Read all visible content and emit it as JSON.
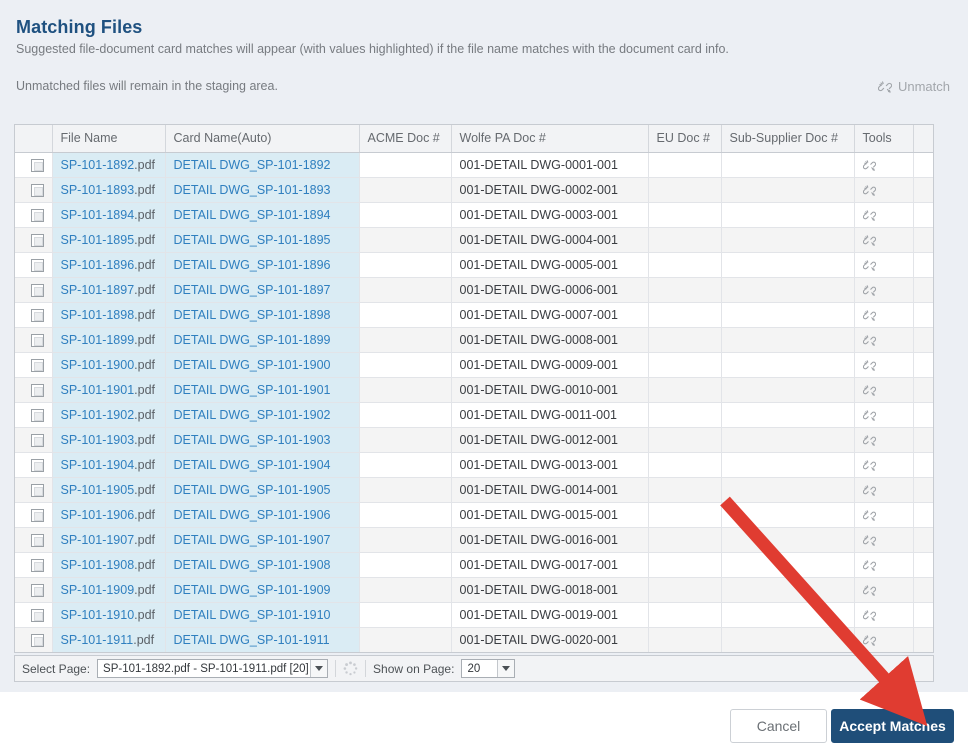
{
  "header": {
    "title": "Matching Files",
    "subtitle_1": "Suggested file-document card matches will appear (with values highlighted) if the file name matches with the document card info.",
    "subtitle_2": "Unmatched files will remain in the staging area.",
    "unmatch_label": "Unmatch",
    "unmatch_icon": "broken-link-icon"
  },
  "table": {
    "columns": [
      "",
      "File Name",
      "Card Name(Auto)",
      "ACME Doc #",
      "Wolfe PA Doc #",
      "EU Doc #",
      "Sub-Supplier Doc #",
      "Tools",
      ""
    ],
    "tools_icon": "broken-link-icon",
    "rows": [
      {
        "file": "SP-101-1892",
        "ext": ".pdf",
        "card": "DETAIL DWG_SP-101-1892",
        "acme": "",
        "wolfe": "001-DETAIL DWG-0001-001",
        "eu": "",
        "sub": ""
      },
      {
        "file": "SP-101-1893",
        "ext": ".pdf",
        "card": "DETAIL DWG_SP-101-1893",
        "acme": "",
        "wolfe": "001-DETAIL DWG-0002-001",
        "eu": "",
        "sub": ""
      },
      {
        "file": "SP-101-1894",
        "ext": ".pdf",
        "card": "DETAIL DWG_SP-101-1894",
        "acme": "",
        "wolfe": "001-DETAIL DWG-0003-001",
        "eu": "",
        "sub": ""
      },
      {
        "file": "SP-101-1895",
        "ext": ".pdf",
        "card": "DETAIL DWG_SP-101-1895",
        "acme": "",
        "wolfe": "001-DETAIL DWG-0004-001",
        "eu": "",
        "sub": ""
      },
      {
        "file": "SP-101-1896",
        "ext": ".pdf",
        "card": "DETAIL DWG_SP-101-1896",
        "acme": "",
        "wolfe": "001-DETAIL DWG-0005-001",
        "eu": "",
        "sub": ""
      },
      {
        "file": "SP-101-1897",
        "ext": ".pdf",
        "card": "DETAIL DWG_SP-101-1897",
        "acme": "",
        "wolfe": "001-DETAIL DWG-0006-001",
        "eu": "",
        "sub": ""
      },
      {
        "file": "SP-101-1898",
        "ext": ".pdf",
        "card": "DETAIL DWG_SP-101-1898",
        "acme": "",
        "wolfe": "001-DETAIL DWG-0007-001",
        "eu": "",
        "sub": ""
      },
      {
        "file": "SP-101-1899",
        "ext": ".pdf",
        "card": "DETAIL DWG_SP-101-1899",
        "acme": "",
        "wolfe": "001-DETAIL DWG-0008-001",
        "eu": "",
        "sub": ""
      },
      {
        "file": "SP-101-1900",
        "ext": ".pdf",
        "card": "DETAIL DWG_SP-101-1900",
        "acme": "",
        "wolfe": "001-DETAIL DWG-0009-001",
        "eu": "",
        "sub": ""
      },
      {
        "file": "SP-101-1901",
        "ext": ".pdf",
        "card": "DETAIL DWG_SP-101-1901",
        "acme": "",
        "wolfe": "001-DETAIL DWG-0010-001",
        "eu": "",
        "sub": ""
      },
      {
        "file": "SP-101-1902",
        "ext": ".pdf",
        "card": "DETAIL DWG_SP-101-1902",
        "acme": "",
        "wolfe": "001-DETAIL DWG-0011-001",
        "eu": "",
        "sub": ""
      },
      {
        "file": "SP-101-1903",
        "ext": ".pdf",
        "card": "DETAIL DWG_SP-101-1903",
        "acme": "",
        "wolfe": "001-DETAIL DWG-0012-001",
        "eu": "",
        "sub": ""
      },
      {
        "file": "SP-101-1904",
        "ext": ".pdf",
        "card": "DETAIL DWG_SP-101-1904",
        "acme": "",
        "wolfe": "001-DETAIL DWG-0013-001",
        "eu": "",
        "sub": ""
      },
      {
        "file": "SP-101-1905",
        "ext": ".pdf",
        "card": "DETAIL DWG_SP-101-1905",
        "acme": "",
        "wolfe": "001-DETAIL DWG-0014-001",
        "eu": "",
        "sub": ""
      },
      {
        "file": "SP-101-1906",
        "ext": ".pdf",
        "card": "DETAIL DWG_SP-101-1906",
        "acme": "",
        "wolfe": "001-DETAIL DWG-0015-001",
        "eu": "",
        "sub": ""
      },
      {
        "file": "SP-101-1907",
        "ext": ".pdf",
        "card": "DETAIL DWG_SP-101-1907",
        "acme": "",
        "wolfe": "001-DETAIL DWG-0016-001",
        "eu": "",
        "sub": ""
      },
      {
        "file": "SP-101-1908",
        "ext": ".pdf",
        "card": "DETAIL DWG_SP-101-1908",
        "acme": "",
        "wolfe": "001-DETAIL DWG-0017-001",
        "eu": "",
        "sub": ""
      },
      {
        "file": "SP-101-1909",
        "ext": ".pdf",
        "card": "DETAIL DWG_SP-101-1909",
        "acme": "",
        "wolfe": "001-DETAIL DWG-0018-001",
        "eu": "",
        "sub": ""
      },
      {
        "file": "SP-101-1910",
        "ext": ".pdf",
        "card": "DETAIL DWG_SP-101-1910",
        "acme": "",
        "wolfe": "001-DETAIL DWG-0019-001",
        "eu": "",
        "sub": ""
      },
      {
        "file": "SP-101-1911",
        "ext": ".pdf",
        "card": "DETAIL DWG_SP-101-1911",
        "acme": "",
        "wolfe": "001-DETAIL DWG-0020-001",
        "eu": "",
        "sub": ""
      }
    ]
  },
  "pagination": {
    "select_page_label": "Select Page:",
    "select_page_value": "SP-101-1892.pdf - SP-101-1911.pdf [20]",
    "refresh_icon": "loading-spinner-icon",
    "show_on_page_label": "Show on Page:",
    "show_on_page_value": "20"
  },
  "footer": {
    "cancel_label": "Cancel",
    "accept_label": "Accept Matches"
  },
  "annotation": {
    "arrow_color": "#e03c31",
    "points_to": "accept-matches-button"
  },
  "colors": {
    "title": "#1f5180",
    "accent_button": "#1f4e79",
    "match_highlight": "#daecf4",
    "link": "#2f7fbf",
    "panel_bg": "#eceff4"
  }
}
